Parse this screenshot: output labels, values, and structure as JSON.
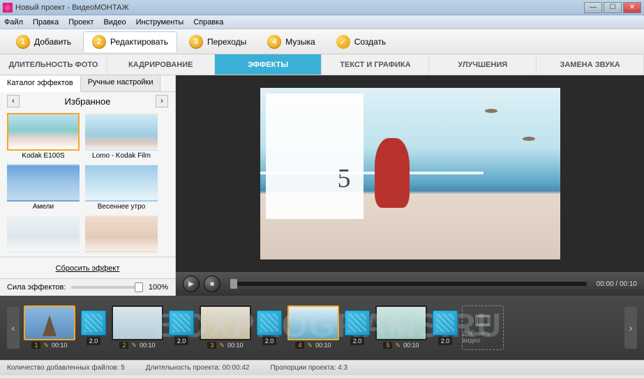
{
  "window": {
    "title": "Новый проект - ВидеоМОНТАЖ"
  },
  "menu": {
    "file": "Файл",
    "edit": "Правка",
    "project": "Проект",
    "video": "Видео",
    "tools": "Инструменты",
    "help": "Справка"
  },
  "steps": {
    "add": "Добавить",
    "edit": "Редактировать",
    "transitions": "Переходы",
    "music": "Музыка",
    "create": "Создать"
  },
  "subtabs": {
    "duration": "ДЛИТЕЛЬНОСТЬ ФОТО",
    "crop": "КАДРИРОВАНИЕ",
    "effects": "ЭФФЕКТЫ",
    "text": "ТЕКСТ И ГРАФИКА",
    "enhance": "УЛУЧШЕНИЯ",
    "audio": "ЗАМЕНА ЗВУКА"
  },
  "sidebar": {
    "tab_catalog": "Каталог эффектов",
    "tab_manual": "Ручные настройки",
    "category": "Избранное",
    "effects": [
      {
        "label": "Kodak E100S"
      },
      {
        "label": "Lomo - Kodak Film"
      },
      {
        "label": "Амели"
      },
      {
        "label": "Весеннее утро"
      },
      {
        "label": ""
      },
      {
        "label": ""
      }
    ],
    "reset": "Сбросить эффект",
    "strength_label": "Сила эффектов:",
    "strength_value": "100%"
  },
  "player": {
    "timecode": "00:00 / 00:10"
  },
  "timeline": {
    "trans_dur": "2.0",
    "clips": [
      {
        "index": "1",
        "dur": "00:10"
      },
      {
        "index": "2",
        "dur": "00:10"
      },
      {
        "index": "3",
        "dur": "00:10"
      },
      {
        "index": "4",
        "dur": "00:10"
      },
      {
        "index": "5",
        "dur": "00:10"
      }
    ],
    "add_label": "Добавить видео"
  },
  "status": {
    "count_label": "Количество добавленных файлов:",
    "count_value": "5",
    "length_label": "Длительность проекта:",
    "length_value": "00:00:42",
    "ratio_label": "Пропорции проекта:",
    "ratio_value": "4:3"
  },
  "watermark": "BOXPROGRAMS.RU"
}
